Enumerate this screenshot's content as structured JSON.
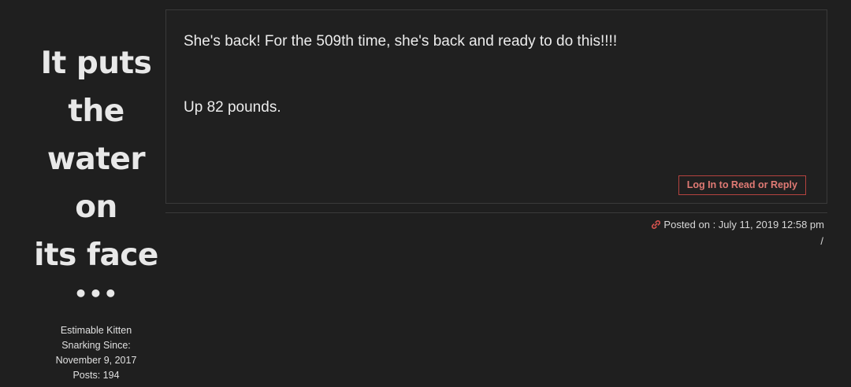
{
  "author": {
    "name_lines": [
      "It puts",
      "the",
      "water on",
      "its face"
    ],
    "more_indicator": "•••",
    "rank": "Estimable Kitten",
    "since_label": "Snarking Since:",
    "since_date": "November 9, 2017",
    "posts": "Posts: 194"
  },
  "post": {
    "paragraphs": [
      "She's back! For the 509th time, she's back and ready to do this!!!!",
      "Up 82 pounds."
    ],
    "reply_button_label": "Log In to Read or Reply"
  },
  "footer": {
    "posted_on": "Posted on : July 11, 2019 12:58 pm",
    "separator": "/",
    "link_icon": "link-icon"
  },
  "colors": {
    "background": "#1f1f1f",
    "accent": "#e07a74",
    "border": "#3a3a3a"
  }
}
